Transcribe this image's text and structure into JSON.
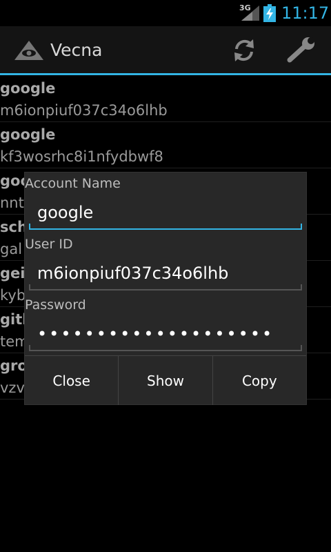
{
  "status_bar": {
    "network": "3G",
    "time": "11:17"
  },
  "action_bar": {
    "title": "Vecna",
    "icons": [
      "eye-triangle-icon",
      "refresh-icon",
      "wrench-icon"
    ],
    "accent_color": "#33b5e5"
  },
  "list": {
    "items": [
      {
        "name": "google",
        "id": "m6ionpiuf037c34o6lhb"
      },
      {
        "name": "google",
        "id": "kf3wosrhc8i1nfydbwf8"
      },
      {
        "name": "goo",
        "id": "nnt"
      },
      {
        "name": "sch",
        "id": "gal"
      },
      {
        "name": "gei",
        "id": "kyb"
      },
      {
        "name": "gith",
        "id": "tem"
      },
      {
        "name": "gro",
        "id": "vzv"
      }
    ]
  },
  "dialog": {
    "account_name_label": "Account Name",
    "account_name_value": "google",
    "user_id_label": "User ID",
    "user_id_value": "m6ionpiuf037c34o6lhb",
    "password_label": "Password",
    "password_value": "••••••••••••••••••••",
    "buttons": {
      "close": "Close",
      "show": "Show",
      "copy": "Copy"
    }
  }
}
